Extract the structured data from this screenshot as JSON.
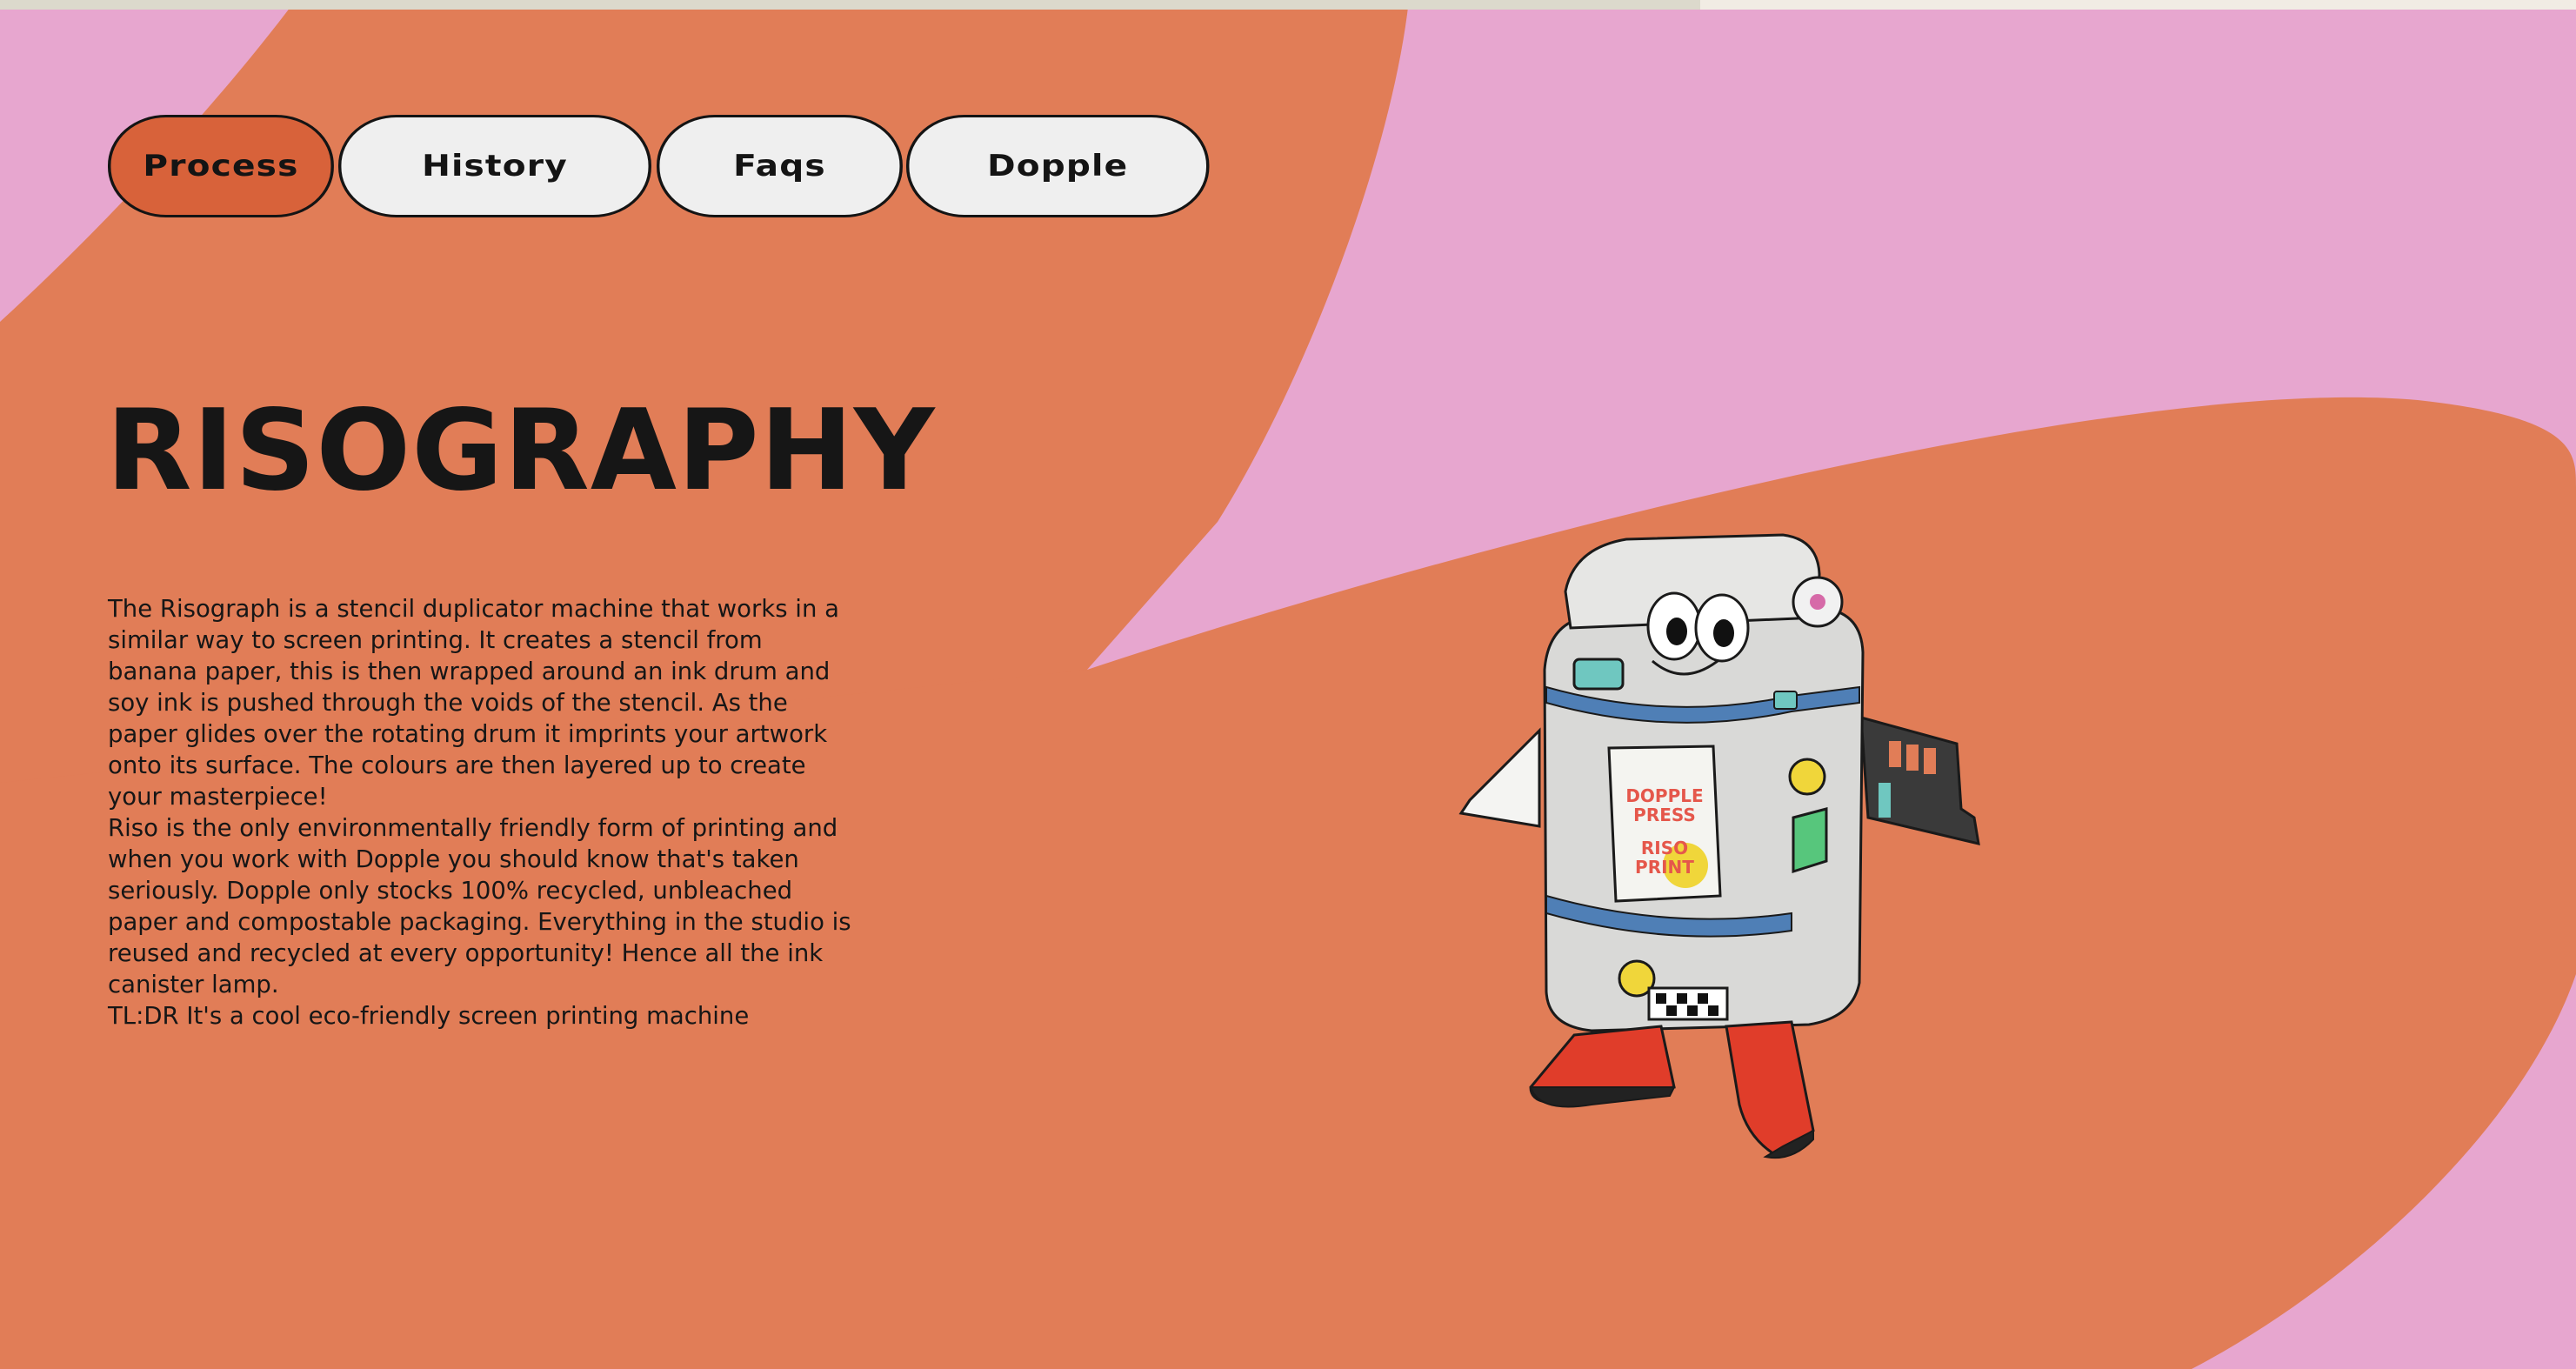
{
  "nav": {
    "items": [
      {
        "label": "Process",
        "active": true
      },
      {
        "label": "History",
        "active": false
      },
      {
        "label": "Faqs",
        "active": false
      },
      {
        "label": "Dopple",
        "active": false
      }
    ]
  },
  "main": {
    "title": "RISOGRAPHY",
    "paragraphs": [
      "The Risograph is a stencil duplicator machine that works in a similar way to screen printing. It creates a stencil from banana paper, this is then wrapped around an ink drum and soy ink is pushed through the voids of the stencil. As the paper glides over the rotating drum it imprints your artwork onto its surface. The colours are then layered up to create your masterpiece!",
      "Riso is the only environmentally friendly form of printing and when you work with Dopple you should know that's taken seriously. Dopple only stocks 100% recycled, unbleached paper and compostable packaging. Everything in the studio is reused and recycled at every opportunity! Hence all the ink canister lamp.",
      "TL:DR It's a cool eco-friendly screen printing machine"
    ]
  },
  "mascot": {
    "sign_line1": "DOPPLE",
    "sign_line2": "PRESS",
    "sign_line3": "RISO",
    "sign_line4": "PRINT"
  },
  "colors": {
    "orange": "#e17d57",
    "pink": "#e7a6cf",
    "active_pill": "#d8623a",
    "pill": "#efefef",
    "text": "#161616"
  }
}
